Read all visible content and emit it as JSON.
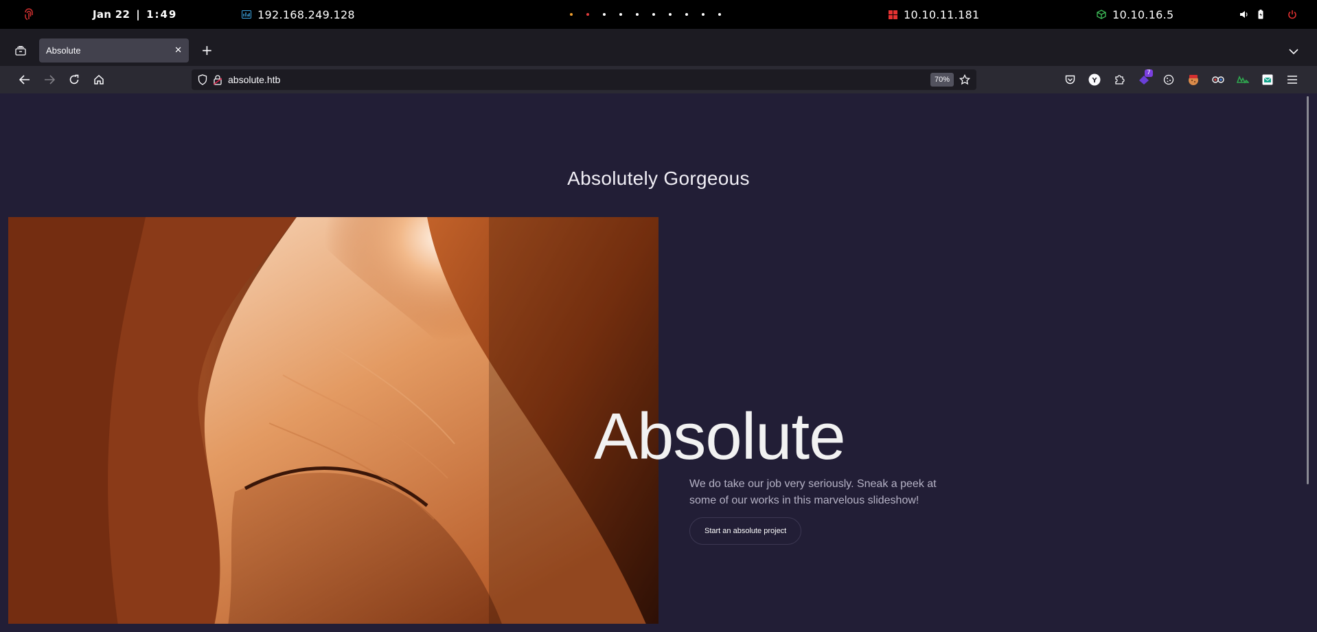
{
  "system_bar": {
    "date": "Jan 22",
    "time": "1:49",
    "vm_ip": "192.168.249.128",
    "target_ip": "10.10.11.181",
    "vpn_ip": "10.10.16.5"
  },
  "browser": {
    "tab_title": "Absolute",
    "url": "absolute.htb",
    "zoom": "70%",
    "extension_badge": "7"
  },
  "page": {
    "headline": "Absolutely Gorgeous",
    "hero_title": "Absolute",
    "hero_description": "We do take our job very seriously. Sneak a peek at some of our works in this marvelous slideshow!",
    "cta_label": "Start an absolute project"
  },
  "colors": {
    "page_bg": "#221e36",
    "toolbar_bg": "#2b2a33",
    "tabbar_bg": "#1c1b22",
    "target_ip_icon": "#e63232",
    "vpn_icon": "#3fbf5a",
    "vm_icon": "#3ea8e6"
  }
}
